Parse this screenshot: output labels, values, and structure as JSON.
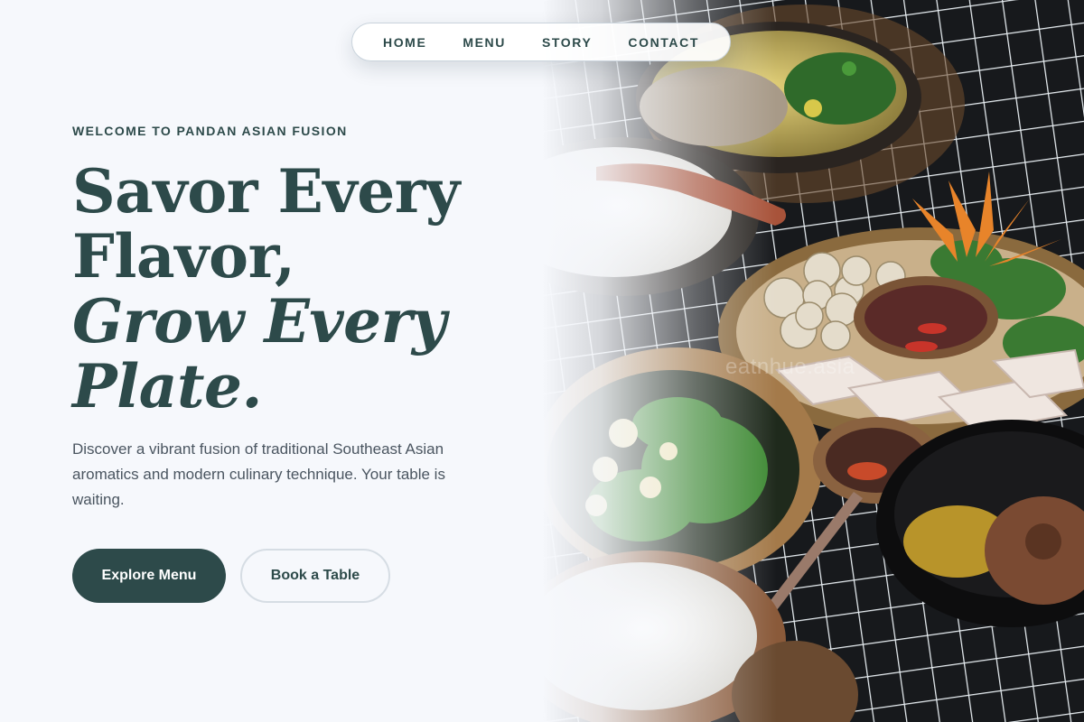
{
  "nav": {
    "items": [
      {
        "label": "HOME"
      },
      {
        "label": "MENU"
      },
      {
        "label": "STORY"
      },
      {
        "label": "CONTACT"
      }
    ]
  },
  "hero": {
    "eyebrow": "WELCOME TO PANDAN ASIAN FUSION",
    "headline_line1": "Savor Every",
    "headline_line2": "Flavor,",
    "headline_line3": "Grow Every",
    "headline_line4": "Plate.",
    "description": "Discover a vibrant fusion of traditional Southeast Asian aromatics and modern culinary technique. Your table is waiting.",
    "primary_cta": "Explore Menu",
    "secondary_cta": "Book a Table"
  },
  "image": {
    "subject": "food-spread-photo",
    "watermark_text": "eatnhue.asia"
  },
  "colors": {
    "accent": "#2d4a4a",
    "background": "#f6f8fc",
    "body_text": "#4a5560",
    "button_text": "#ffffff"
  }
}
